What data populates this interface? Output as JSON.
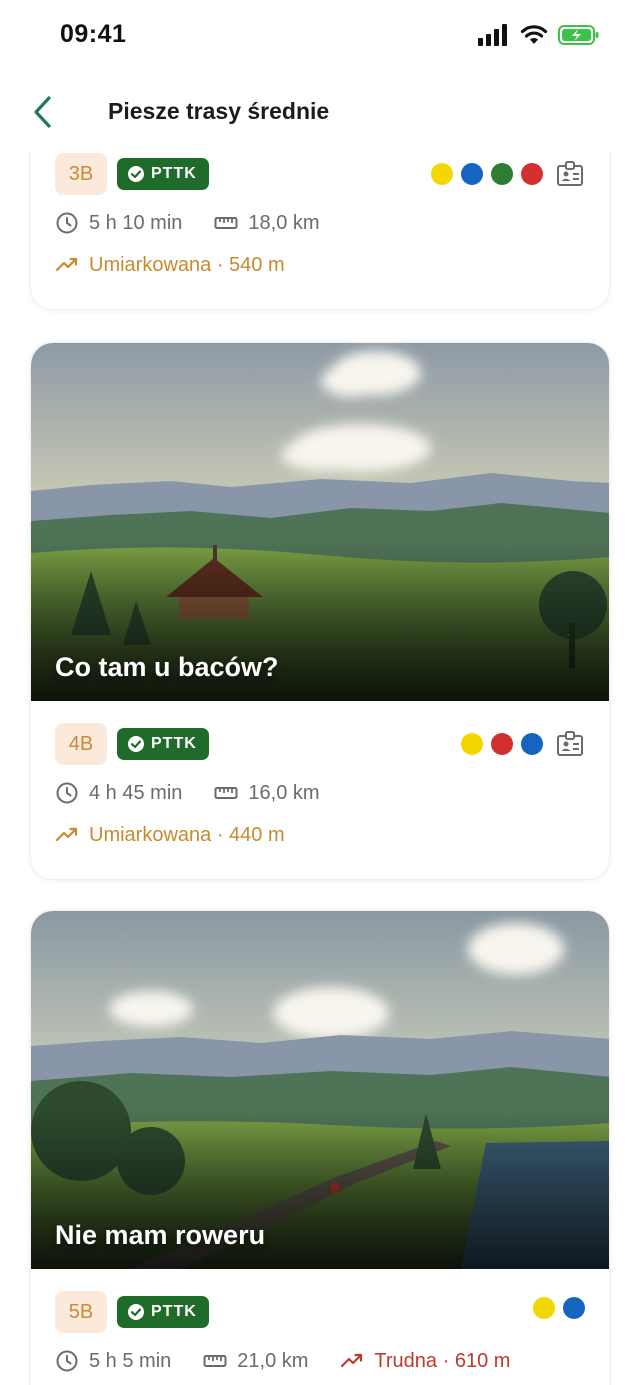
{
  "status": {
    "time": "09:41"
  },
  "nav": {
    "title": "Piesze trasy średnie"
  },
  "routes": [
    {
      "title": "",
      "grade": "3B",
      "badge": "PTTK",
      "markers": [
        "#f2d800",
        "#1565c0",
        "#2e7d32",
        "#d32f2f"
      ],
      "has_id": true,
      "duration": "5 h 10 min",
      "distance": "18,0 km",
      "difficulty": "Umiarkowana · 540 m"
    },
    {
      "title": "Co tam u baców?",
      "grade": "4B",
      "badge": "PTTK",
      "markers": [
        "#f2d800",
        "#d32f2f",
        "#1565c0"
      ],
      "has_id": true,
      "duration": "4 h 45 min",
      "distance": "16,0 km",
      "difficulty": "Umiarkowana · 440 m"
    },
    {
      "title": "Nie mam roweru",
      "grade": "5B",
      "badge": "PTTK",
      "markers": [
        "#f2d800",
        "#1565c0"
      ],
      "has_id": false,
      "duration": "5 h 5 min",
      "distance": "21,0 km",
      "difficulty": "Trudna · 610 m"
    }
  ],
  "colors": {
    "accent": "#1f6b2a",
    "moderate": "#c98a2e",
    "hard": "#c0392b",
    "back": "#1f7a5a"
  },
  "icons": [
    "back-chevron-icon",
    "signal-icon",
    "wifi-icon",
    "battery-icon",
    "clock-icon",
    "ruler-icon",
    "trend-up-icon",
    "id-card-icon",
    "check-badge-icon"
  ]
}
